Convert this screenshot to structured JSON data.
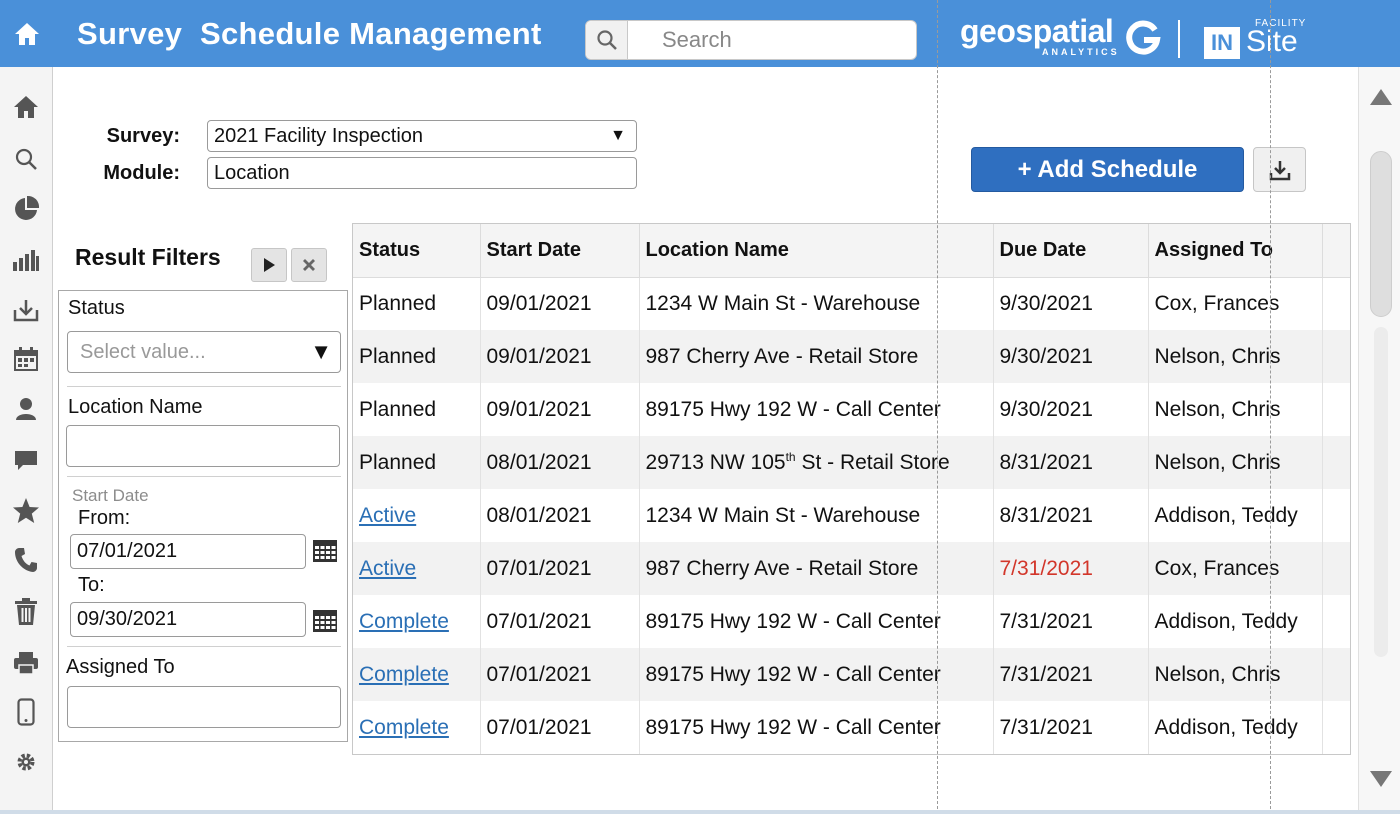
{
  "header": {
    "title": "Survey  Schedule Management",
    "search_placeholder": "Search",
    "brand_name": "geospatial",
    "brand_sub": "ANALYTICS",
    "insite_in": "IN",
    "insite_site": "Site",
    "insite_facility": "FACILITY",
    "accent_color": "#4a90d9"
  },
  "sidebar": {
    "icons": [
      "home-icon",
      "search-icon",
      "pie-chart-icon",
      "bar-chart-icon",
      "download-tray-icon",
      "calendar-icon",
      "person-icon",
      "chat-icon",
      "star-icon",
      "phone-icon",
      "trash-icon",
      "printer-icon",
      "mobile-icon",
      "gear-icon"
    ]
  },
  "form": {
    "survey_label": "Survey:",
    "survey_value": "2021 Facility Inspection",
    "module_label": "Module:",
    "module_value": "Location"
  },
  "actions": {
    "add_schedule": "+ Add Schedule"
  },
  "filters": {
    "title": "Result Filters",
    "status_label": "Status",
    "status_placeholder": "Select value...",
    "location_label": "Location Name",
    "location_value": "",
    "start_date_label": "Start Date",
    "from_label": "From:",
    "from_value": "07/01/2021",
    "to_label": "To:",
    "to_value": "09/30/2021",
    "assigned_label": "Assigned To",
    "assigned_value": ""
  },
  "table": {
    "columns": [
      "Status",
      "Start Date",
      "Location Name",
      "Due Date",
      "Assigned To"
    ],
    "rows": [
      {
        "status": "Planned",
        "start": "09/01/2021",
        "location": "1234 W Main St - Warehouse",
        "due": "9/30/2021",
        "assigned": "Cox, Frances"
      },
      {
        "status": "Planned",
        "start": "09/01/2021",
        "location": "987 Cherry Ave - Retail Store",
        "due": "9/30/2021",
        "assigned": "Nelson, Chris"
      },
      {
        "status": "Planned",
        "start": "09/01/2021",
        "location": "89175 Hwy 192 W - Call Center",
        "due": "9/30/2021",
        "assigned": "Nelson, Chris"
      },
      {
        "status": "Planned",
        "start": "08/01/2021",
        "location_pre": "29713 NW 105",
        "location_sup": "th",
        "location_post": " St - Retail Store",
        "due": "8/31/2021",
        "assigned": "Nelson, Chris"
      },
      {
        "status": "Active",
        "start": "08/01/2021",
        "location": "1234 W Main St - Warehouse",
        "due": "8/31/2021",
        "assigned": "Addison, Teddy"
      },
      {
        "status": "Active",
        "start": "07/01/2021",
        "location": "987 Cherry Ave - Retail Store",
        "due": "7/31/2021",
        "assigned": "Cox, Frances"
      },
      {
        "status": "Complete",
        "start": "07/01/2021",
        "location": "89175 Hwy 192 W - Call Center",
        "due": "7/31/2021",
        "assigned": "Addison, Teddy"
      },
      {
        "status": "Complete",
        "start": "07/01/2021",
        "location": "89175 Hwy 192 W - Call Center",
        "due": "7/31/2021",
        "assigned": "Nelson, Chris"
      },
      {
        "status": "Complete",
        "start": "07/01/2021",
        "location": "89175 Hwy 192 W - Call Center",
        "due": "7/31/2021",
        "assigned": "Addison, Teddy"
      }
    ],
    "overdue_color": "#d2362a",
    "link_color": "#2a6fb5"
  }
}
